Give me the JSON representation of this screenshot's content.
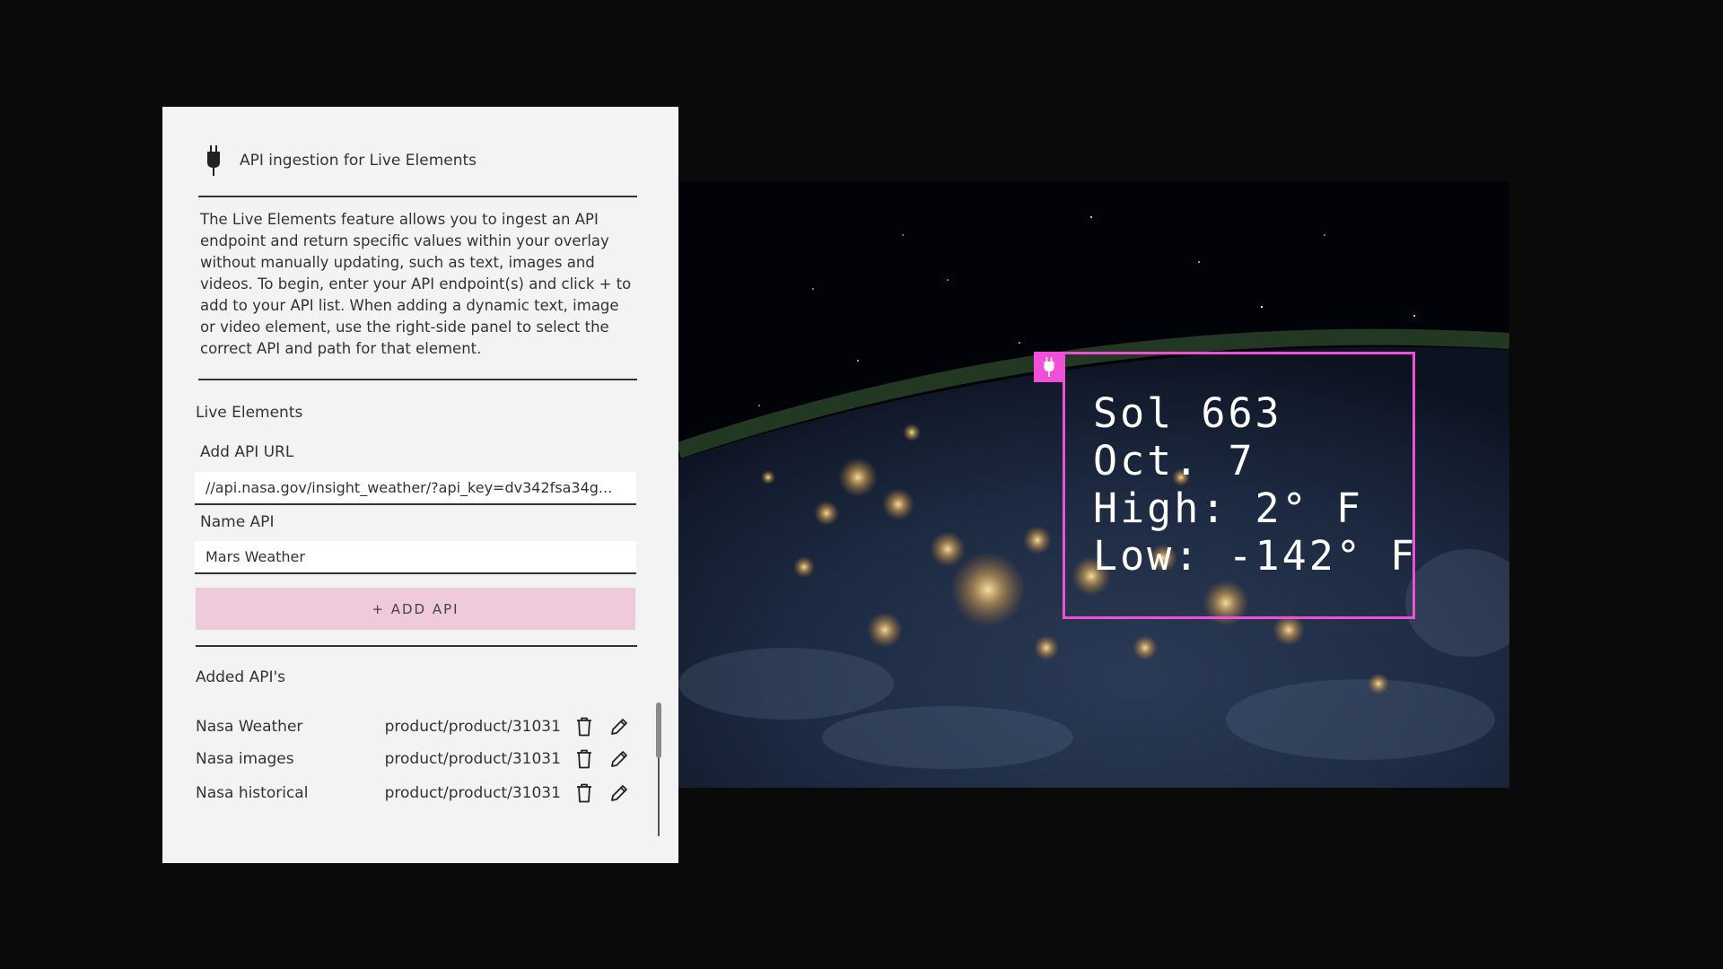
{
  "panel": {
    "title": "API ingestion for Live Elements",
    "description": "The Live Elements feature allows you to ingest an API endpoint and return specific values within your overlay without manually updating, such as text, images and videos. To begin, enter your API endpoint(s) and click + to add to your API list. When adding a dynamic text, image or video element, use the right-side panel to select the correct API and path for that element.",
    "live_elements_label": "Live Elements",
    "api_url_label": "Add API URL",
    "api_url_value": "//api.nasa.gov/insight_weather/?api_key=dv342fsa34g...",
    "name_api_label": "Name API",
    "name_api_value": "Mars Weather",
    "add_api_button": "+ ADD API",
    "added_apis_label": "Added API's",
    "added_apis": [
      {
        "name": "Nasa Weather",
        "path": "product/product/31031"
      },
      {
        "name": "Nasa images",
        "path": "product/product/31031"
      },
      {
        "name": "Nasa historical",
        "path": "product/product/31031"
      }
    ],
    "row_icons": [
      "trash-icon",
      "pencil-icon"
    ],
    "header_icon": "plug-icon"
  },
  "overlay": {
    "lines": [
      "Sol 663",
      "Oct. 7",
      "High: 2° F",
      "Low: -142° F"
    ],
    "accent_color": "#f04fd8",
    "tag_icon": "plug-icon"
  },
  "colors": {
    "background": "#0a0a0a",
    "panel_bg": "#f3f3f3",
    "button_bg": "#efcadb",
    "accent": "#f04fd8"
  }
}
